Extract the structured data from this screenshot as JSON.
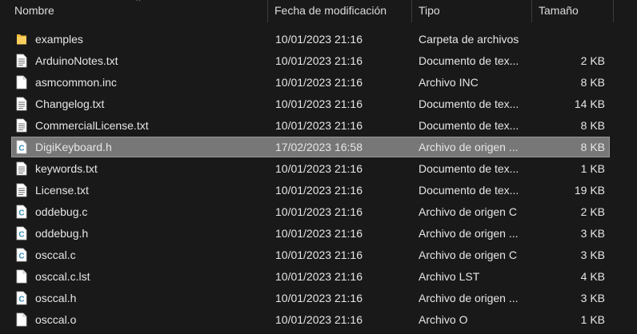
{
  "header": {
    "name": "Nombre",
    "date": "Fecha de modificación",
    "type": "Tipo",
    "size": "Tamaño"
  },
  "files": [
    {
      "name": "examples",
      "date": "10/01/2023 21:16",
      "type": "Carpeta de archivos",
      "size": "",
      "icon": "folder-icon"
    },
    {
      "name": "ArduinoNotes.txt",
      "date": "10/01/2023 21:16",
      "type": "Documento de tex...",
      "size": "2 KB",
      "icon": "text-file-icon"
    },
    {
      "name": "asmcommon.inc",
      "date": "10/01/2023 21:16",
      "type": "Archivo INC",
      "size": "8 KB",
      "icon": "file-icon"
    },
    {
      "name": "Changelog.txt",
      "date": "10/01/2023 21:16",
      "type": "Documento de tex...",
      "size": "14 KB",
      "icon": "text-file-icon"
    },
    {
      "name": "CommercialLicense.txt",
      "date": "10/01/2023 21:16",
      "type": "Documento de tex...",
      "size": "8 KB",
      "icon": "text-file-icon"
    },
    {
      "name": "DigiKeyboard.h",
      "date": "17/02/2023 16:58",
      "type": "Archivo de origen ...",
      "size": "8 KB",
      "icon": "c-source-file-icon",
      "selected": true
    },
    {
      "name": "keywords.txt",
      "date": "10/01/2023 21:16",
      "type": "Documento de tex...",
      "size": "1 KB",
      "icon": "text-file-icon"
    },
    {
      "name": "License.txt",
      "date": "10/01/2023 21:16",
      "type": "Documento de tex...",
      "size": "19 KB",
      "icon": "text-file-icon"
    },
    {
      "name": "oddebug.c",
      "date": "10/01/2023 21:16",
      "type": "Archivo de origen C",
      "size": "2 KB",
      "icon": "c-source-file-icon"
    },
    {
      "name": "oddebug.h",
      "date": "10/01/2023 21:16",
      "type": "Archivo de origen ...",
      "size": "3 KB",
      "icon": "c-source-file-icon"
    },
    {
      "name": "osccal.c",
      "date": "10/01/2023 21:16",
      "type": "Archivo de origen C",
      "size": "3 KB",
      "icon": "c-source-file-icon"
    },
    {
      "name": "osccal.c.lst",
      "date": "10/01/2023 21:16",
      "type": "Archivo LST",
      "size": "4 KB",
      "icon": "file-icon"
    },
    {
      "name": "osccal.h",
      "date": "10/01/2023 21:16",
      "type": "Archivo de origen ...",
      "size": "3 KB",
      "icon": "c-source-file-icon"
    },
    {
      "name": "osccal.o",
      "date": "10/01/2023 21:16",
      "type": "Archivo O",
      "size": "1 KB",
      "icon": "file-icon"
    }
  ],
  "colors": {
    "background": "#191919",
    "selection": "#777777",
    "folder": "#f5c542",
    "c_accent": "#3c8dbc"
  }
}
